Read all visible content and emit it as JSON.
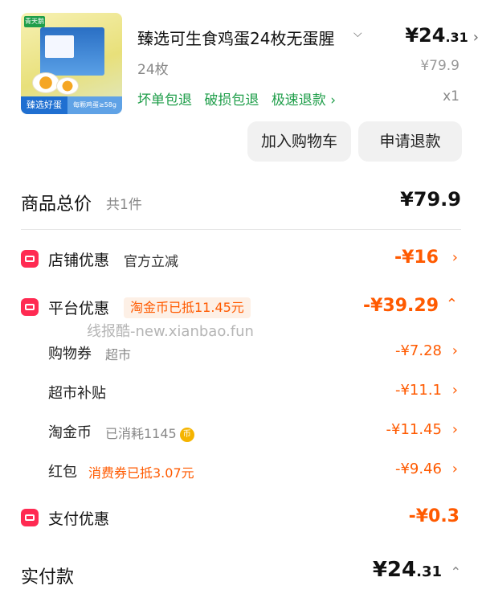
{
  "product": {
    "title": "臻选可生食鸡蛋24枚无蛋腥",
    "price_int": "¥24",
    "price_dec": ".31",
    "spec": "24枚",
    "original_price": "¥79.9",
    "tags": [
      "坏单包退",
      "破损包退",
      "极速退款 ›"
    ],
    "quantity": "x1",
    "thumb_brand": "青天鹅",
    "thumb_tag1": "臻选好蛋",
    "thumb_tag2": "每颗鸡蛋≥58g"
  },
  "buttons": {
    "add_to_cart": "加入购物车",
    "refund": "申请退款"
  },
  "total": {
    "label": "商品总价",
    "count": "共1件",
    "value": "¥79.9"
  },
  "store_discount": {
    "title": "店铺优惠",
    "sub": "官方立减",
    "value": "-¥16"
  },
  "platform_discount": {
    "title": "平台优惠",
    "badge": "淘金币已抵11.45元",
    "value": "-¥39.29",
    "items": [
      {
        "title": "购物券",
        "note": "超市",
        "value": "-¥7.28"
      },
      {
        "title": "超市补贴",
        "note": "",
        "value": "-¥11.1"
      },
      {
        "title": "淘金币",
        "note": "已消耗1145",
        "value": "-¥11.45"
      },
      {
        "title": "红包",
        "note": "消费券已抵3.07元",
        "value": "-¥9.46"
      }
    ]
  },
  "payment_discount": {
    "title": "支付优惠",
    "value": "-¥0.3"
  },
  "actual_pay": {
    "label": "实付款",
    "int": "¥24",
    "dec": ".31"
  },
  "watermark": "线报酷-new.xianbao.fun",
  "colors": {
    "accent": "#ff5a00",
    "green": "#1f9e4a",
    "icon_red": "#ff2a52"
  }
}
